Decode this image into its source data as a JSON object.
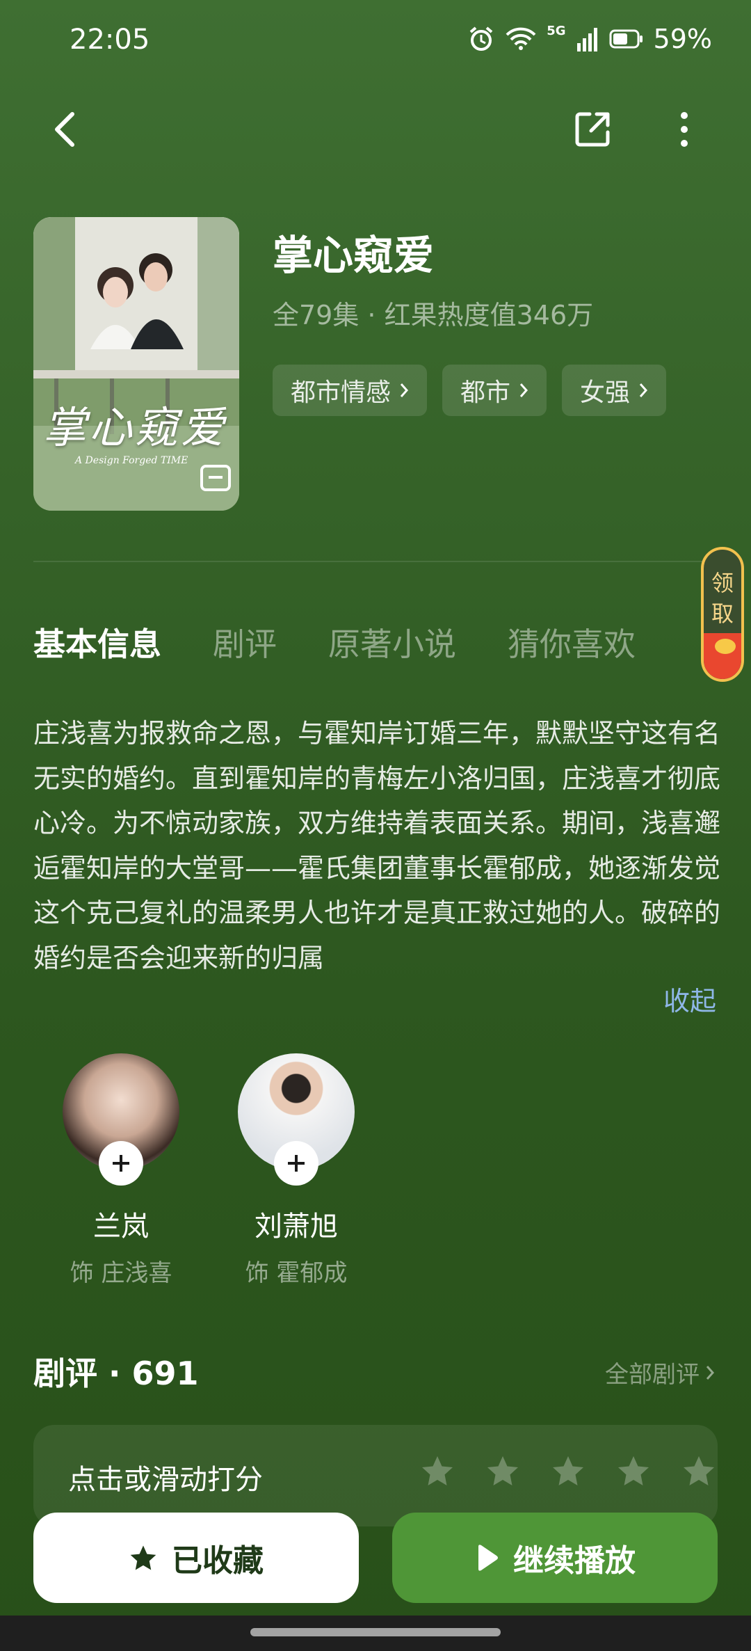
{
  "status_bar": {
    "time": "22:05",
    "network": "5G",
    "battery": "59%"
  },
  "show": {
    "title": "掌心窥爱",
    "meta": "全79集 · 红果热度值346万",
    "poster_title": "掌心窥爱",
    "poster_subtitle": "A Design Forged TIME",
    "tags": [
      "都市情感",
      "都市",
      "女强"
    ]
  },
  "reward": {
    "label": "领取"
  },
  "tabs": [
    "基本信息",
    "剧评",
    "原著小说",
    "猜你喜欢"
  ],
  "synopsis": {
    "text": "庄浅喜为报救命之恩，与霍知岸订婚三年，默默坚守这有名无实的婚约。直到霍知岸的青梅左小洛归国，庄浅喜才彻底心冷。为不惊动家族，双方维持着表面关系。期间，浅喜邂逅霍知岸的大堂哥——霍氏集团董事长霍郁成，她逐渐发觉这个克己复礼的温柔男人也许才是真正救过她的人。破碎的婚约是否会迎来新的归属",
    "collapse_label": "收起"
  },
  "cast": [
    {
      "name": "兰岚",
      "role": "饰 庄浅喜"
    },
    {
      "name": "刘萧旭",
      "role": "饰 霍郁成"
    }
  ],
  "reviews": {
    "title": "剧评 · 691",
    "all_label": "全部剧评",
    "rate_label": "点击或滑动打分",
    "rating": 0,
    "max_rating": 5
  },
  "actions": {
    "favorite_label": "已收藏",
    "play_label": "继续播放"
  },
  "colors": {
    "accent": "#4f9637",
    "link": "#8fb7e8"
  }
}
